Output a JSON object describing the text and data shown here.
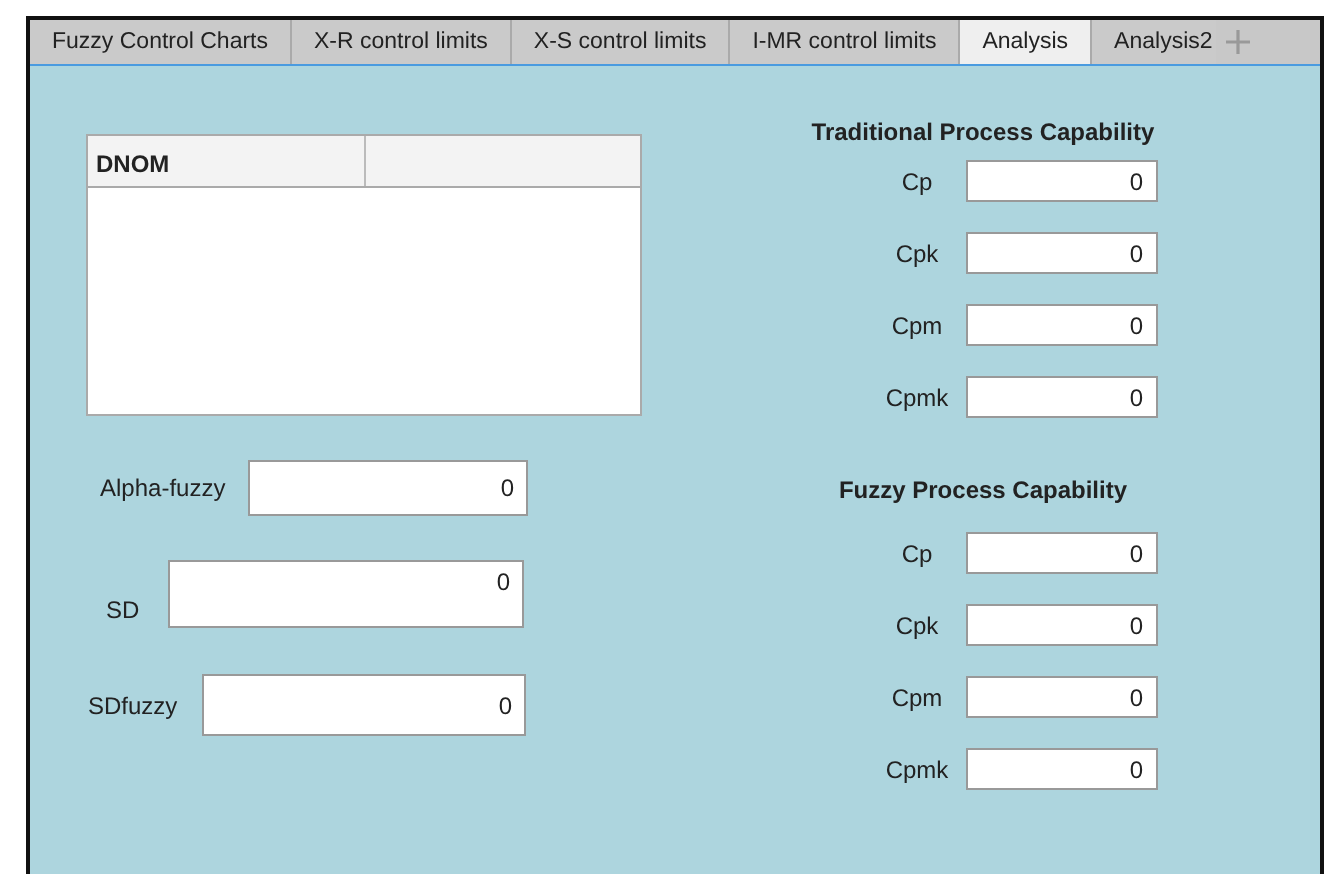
{
  "tabs": [
    {
      "label": "Fuzzy Control Charts",
      "selected": false
    },
    {
      "label": "X-R control limits",
      "selected": false
    },
    {
      "label": "X-S control limits",
      "selected": false
    },
    {
      "label": "I-MR control limits",
      "selected": false
    },
    {
      "label": "Analysis",
      "selected": true
    },
    {
      "label": "Analysis2",
      "selected": false
    }
  ],
  "table": {
    "columns": [
      "DNOM",
      ""
    ]
  },
  "left_fields": [
    {
      "label": "Alpha-fuzzy",
      "value": "0"
    },
    {
      "label": "SD",
      "value": "0"
    },
    {
      "label": "SDfuzzy",
      "value": "0"
    }
  ],
  "sections": [
    {
      "title": "Traditional Process Capability",
      "fields": [
        {
          "label": "Cp",
          "value": "0"
        },
        {
          "label": "Cpk",
          "value": "0"
        },
        {
          "label": "Cpm",
          "value": "0"
        },
        {
          "label": "Cpmk",
          "value": "0"
        }
      ]
    },
    {
      "title": "Fuzzy Process Capability",
      "fields": [
        {
          "label": "Cp",
          "value": "0"
        },
        {
          "label": "Cpk",
          "value": "0"
        },
        {
          "label": "Cpm",
          "value": "0"
        },
        {
          "label": "Cpmk",
          "value": "0"
        }
      ]
    }
  ]
}
